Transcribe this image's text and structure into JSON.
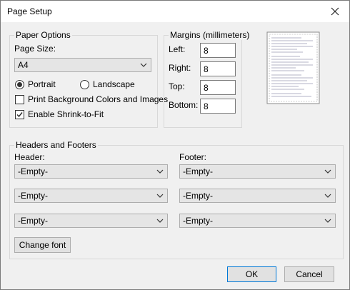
{
  "dialog": {
    "title": "Page Setup"
  },
  "paper_options": {
    "legend": "Paper Options",
    "page_size_label": "Page Size:",
    "page_size_value": "A4",
    "portrait_label": "Portrait",
    "landscape_label": "Landscape",
    "orientation_selected": "Portrait",
    "print_bg_label": "Print Background Colors and Images",
    "print_bg_checked": false,
    "shrink_label": "Enable Shrink-to-Fit",
    "shrink_checked": true
  },
  "margins": {
    "legend": "Margins (millimeters)",
    "left_label": "Left:",
    "left_value": "8",
    "right_label": "Right:",
    "right_value": "8",
    "top_label": "Top:",
    "top_value": "8",
    "bottom_label": "Bottom:",
    "bottom_value": "8"
  },
  "headers_footers": {
    "legend": "Headers and Footers",
    "header_label": "Header:",
    "footer_label": "Footer:",
    "header_values": [
      "-Empty-",
      "-Empty-",
      "-Empty-"
    ],
    "footer_values": [
      "-Empty-",
      "-Empty-",
      "-Empty-"
    ],
    "change_font_label": "Change font"
  },
  "buttons": {
    "ok_label": "OK",
    "cancel_label": "Cancel"
  },
  "icons": {
    "close": "close-icon",
    "dropdown": "chevron-down-icon",
    "check": "checkmark-icon"
  },
  "colors": {
    "focus_border": "#0078d7",
    "dialog_bg": "#f0f0f0"
  }
}
